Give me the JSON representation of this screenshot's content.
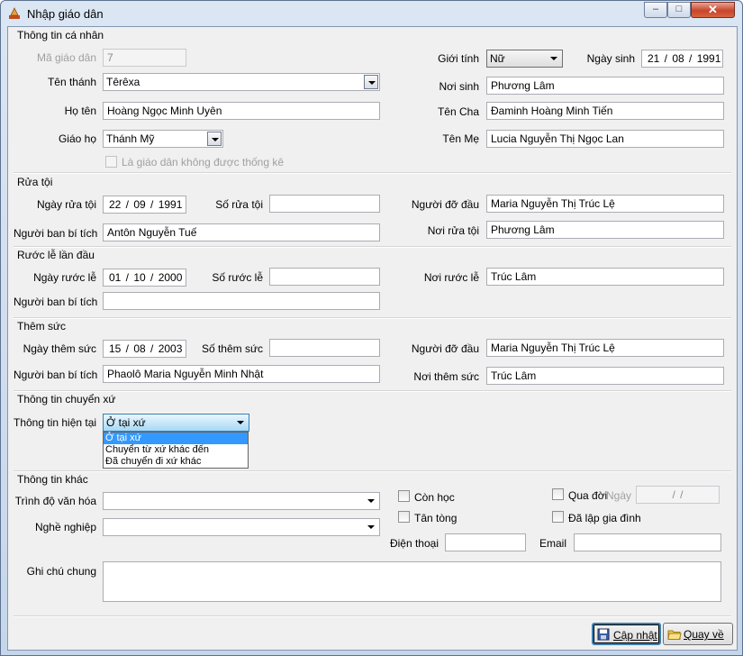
{
  "window": {
    "title": "Nhập giáo dân"
  },
  "personal": {
    "section": "Thông tin cá nhân",
    "ma_label": "Mã giáo dân",
    "ma_value": "7",
    "tenthanh_label": "Tên thánh",
    "tenthanh_value": "Têrêxa",
    "hoten_label": "Họ tên",
    "hoten_value": "Hoàng Ngọc Minh Uyên",
    "giaoho_label": "Giáo họ",
    "giaoho_value": "Thánh Mỹ",
    "nothongke_label": "Là giáo dân không được thống kê",
    "gioitinh_label": "Giới tính",
    "gioitinh_value": "Nữ",
    "ngaysinh_label": "Ngày sinh",
    "ngaysinh_value": "21 / 08 / 1991",
    "noisinh_label": "Nơi sinh",
    "noisinh_value": "Phương Lâm",
    "tencha_label": "Tên Cha",
    "tencha_value": "Đaminh Hoàng Minh Tiến",
    "tenme_label": "Tên Mẹ",
    "tenme_value": "Lucia Nguyễn Thị Ngọc Lan"
  },
  "ruatoi": {
    "section": "Rửa tội",
    "ngay_label": "Ngày rửa tội",
    "ngay_value": "22 / 09 / 1991",
    "so_label": "Số rửa tội",
    "so_value": "",
    "nguoidodau_label": "Người đỡ đầu",
    "nguoidodau_value": "Maria Nguyễn Thị Trúc Lệ",
    "nguoiban_label": "Người ban bí tích",
    "nguoiban_value": "Antôn Nguyễn Tuế",
    "noi_label": "Nơi rửa tội",
    "noi_value": "Phương Lâm"
  },
  "ruocle": {
    "section": "Rước lễ lần đầu",
    "ngay_label": "Ngày rước lễ",
    "ngay_value": "01 / 10 / 2000",
    "so_label": "Số rước lễ",
    "so_value": "",
    "noi_label": "Nơi rước lễ",
    "noi_value": "Trúc Lâm",
    "nguoiban_label": "Người ban bí tích",
    "nguoiban_value": ""
  },
  "themsuc": {
    "section": "Thêm sức",
    "ngay_label": "Ngày thêm sức",
    "ngay_value": "15 / 08 / 2003",
    "so_label": "Số thêm sức",
    "so_value": "",
    "nguoidodau_label": "Người đỡ đầu",
    "nguoidodau_value": "Maria Nguyễn Thị Trúc Lệ",
    "nguoiban_label": "Người ban bí tích",
    "nguoiban_value": "Phaolô Maria Nguyễn Minh Nhật",
    "noi_label": "Nơi thêm sức",
    "noi_value": "Trúc Lâm"
  },
  "chuyenxu": {
    "section": "Thông tin chuyển xứ",
    "hientai_label": "Thông tin hiện tại",
    "hientai_value": "Ở tại xứ",
    "options": [
      "Ở tại xứ",
      "Chuyển từ xứ khác đến",
      "Đã chuyển đi xứ khác"
    ]
  },
  "khac": {
    "section": "Thông tin khác",
    "trinhdo_label": "Trình độ văn hóa",
    "trinhdo_value": "",
    "nghenghiep_label": "Nghề nghiệp",
    "nghenghiep_value": "",
    "conhoc_label": "Còn học",
    "tantong_label": "Tân tòng",
    "quadoi_label": "Qua đời",
    "ngay_label": "Ngày",
    "ngay_value": "/   /",
    "dalapgiadinh_label": "Đã lập gia đình",
    "dienthoai_label": "Điện thoại",
    "dienthoai_value": "",
    "email_label": "Email",
    "email_value": "",
    "ghichu_label": "Ghi chú chung",
    "ghichu_value": ""
  },
  "buttons": {
    "capnhat": "Cập nhật",
    "quayve": "Quay về"
  }
}
